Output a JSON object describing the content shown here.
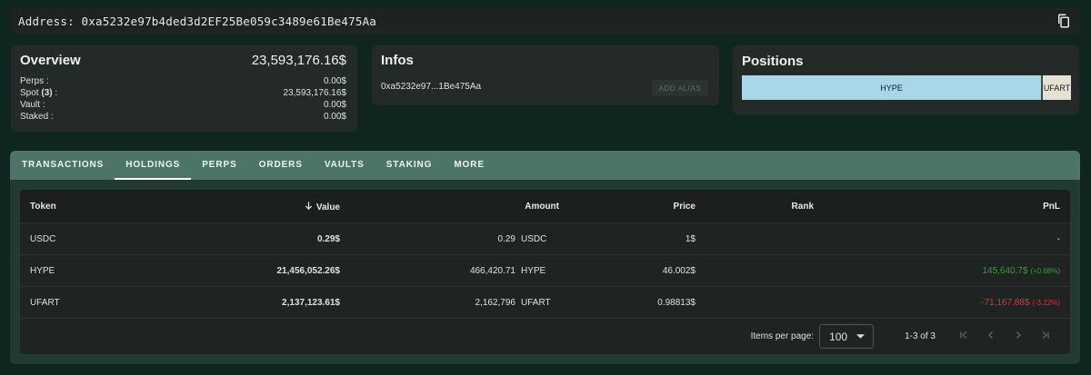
{
  "address_bar": {
    "label": "Address:",
    "value": "0xa5232e97b4ded3d2EF25Be059c3489e61Be475Aa"
  },
  "overview": {
    "title": "Overview",
    "total": "23,593,176.16$",
    "rows": [
      {
        "label": "Perps :",
        "value": "0.00$"
      },
      {
        "label_prefix": "Spot ",
        "label_count": "(3)",
        "label_suffix": " :",
        "value": "23,593,176.16$"
      },
      {
        "label": "Vault :",
        "value": "0.00$"
      },
      {
        "label": "Staked :",
        "value": "0.00$"
      }
    ]
  },
  "infos": {
    "title": "Infos",
    "short_address": "0xa5232e97...1Be475Aa",
    "add_alias_label": "ADD ALIAS"
  },
  "positions": {
    "title": "Positions",
    "segments": [
      {
        "label": "HYPE",
        "share": 0.909,
        "color": "#a9d7ea"
      },
      {
        "label": "UFART",
        "share": 0.091,
        "color": "#e5e2d2"
      }
    ]
  },
  "tabs": [
    "TRANSACTIONS",
    "HOLDINGS",
    "PERPS",
    "ORDERS",
    "VAULTS",
    "STAKING",
    "MORE"
  ],
  "active_tab": "HOLDINGS",
  "table": {
    "headers": {
      "token": "Token",
      "value": "Value",
      "amount": "Amount",
      "price": "Price",
      "rank": "Rank",
      "pnl": "PnL"
    },
    "sort_icon": "arrow-down-icon",
    "rows": [
      {
        "token": "USDC",
        "value": "0.29$",
        "amount": "0.29",
        "unit": "USDC",
        "price": "1$",
        "rank": "",
        "pnl": "-",
        "pnl_pct": "",
        "pnl_sign": "none"
      },
      {
        "token": "HYPE",
        "value": "21,456,052.26$",
        "amount": "466,420.71",
        "unit": "HYPE",
        "price": "46.002$",
        "rank": "",
        "pnl": "145,640.7$",
        "pnl_pct": "(+0.68%)",
        "pnl_sign": "pos"
      },
      {
        "token": "UFART",
        "value": "2,137,123.61$",
        "amount": "2,162,796",
        "unit": "UFART",
        "price": "0.98813$",
        "rank": "",
        "pnl": "-71,167.88$",
        "pnl_pct": "(-3.22%)",
        "pnl_sign": "neg"
      }
    ]
  },
  "pager": {
    "items_per_page_label": "Items per page:",
    "items_per_page": "100",
    "range": "1-3 of 3"
  },
  "colors": {
    "positive": "#3a9a3e",
    "negative": "#e03030",
    "tab_bar": "#4d7468"
  }
}
